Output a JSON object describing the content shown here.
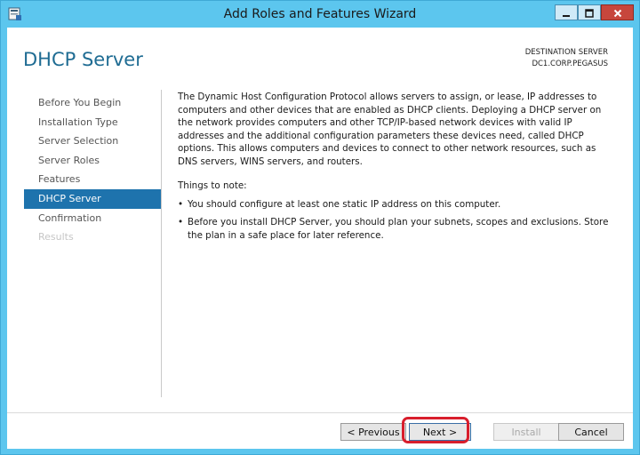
{
  "window": {
    "title": "Add Roles and Features Wizard",
    "colors": {
      "titlebar": "#5cc6ee",
      "accent": "#1e73ad",
      "heading": "#1f6c93",
      "close": "#c7463c",
      "annotation": "#d81e2c"
    },
    "icons": [
      "server-manager-icon",
      "minimize-icon",
      "maximize-icon",
      "close-icon"
    ]
  },
  "header": {
    "page_title": "DHCP Server",
    "destination_label": "DESTINATION SERVER",
    "destination_value": "DC1.CORP.PEGASUS"
  },
  "sidebar": {
    "items": [
      {
        "label": "Before You Begin"
      },
      {
        "label": "Installation Type"
      },
      {
        "label": "Server Selection"
      },
      {
        "label": "Server Roles"
      },
      {
        "label": "Features"
      },
      {
        "label": "DHCP Server",
        "state": "active"
      },
      {
        "label": "Confirmation"
      },
      {
        "label": "Results",
        "state": "disabled"
      }
    ]
  },
  "content": {
    "intro": "The Dynamic Host Configuration Protocol allows servers to assign, or lease, IP addresses to computers and other devices that are enabled as DHCP clients. Deploying a DHCP server on the network provides computers and other TCP/IP-based network devices with valid IP addresses and the additional configuration parameters these devices need, called DHCP options. This allows computers and devices to connect to other network resources, such as DNS servers, WINS servers, and routers.",
    "notes_heading": "Things to note:",
    "notes": [
      "You should configure at least one static IP address on this computer.",
      "Before you install DHCP Server, you should plan your subnets, scopes and exclusions. Store the plan in a safe place for later reference."
    ]
  },
  "footer": {
    "previous_label": "< Previous",
    "next_label": "Next >",
    "install_label": "Install",
    "cancel_label": "Cancel"
  }
}
